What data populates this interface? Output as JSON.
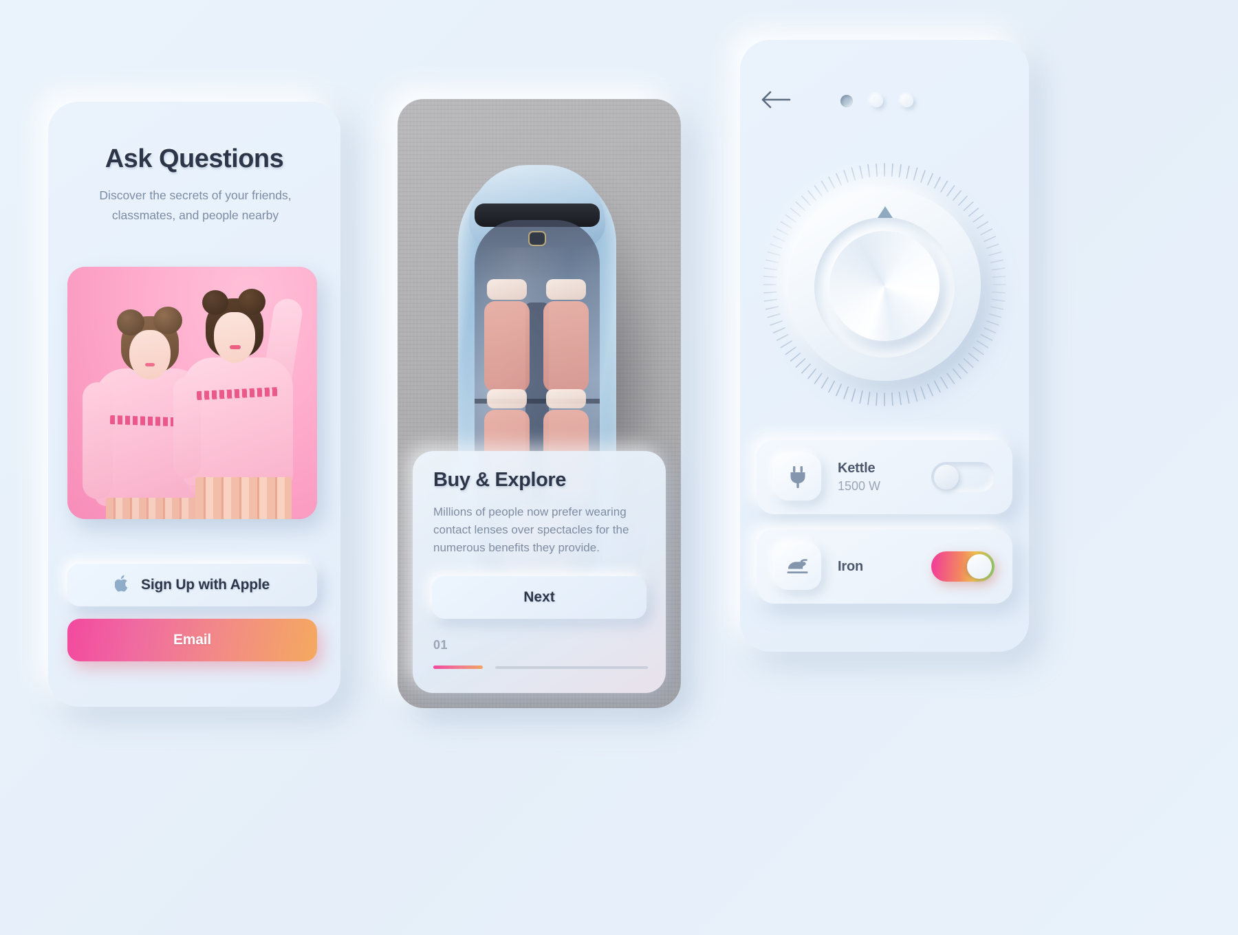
{
  "theme": {
    "background": "#e8f1fa",
    "card_surface": "#eaf3fc",
    "text_dark": "#2c3648",
    "text_muted": "#7b8ba3",
    "gradient_start": "#f3499f",
    "gradient_end": "#f5a95f"
  },
  "card_one": {
    "title": "Ask Questions",
    "subtitle": "Discover the secrets of your friends, classmates, and people nearby",
    "photo": {
      "alt": "Two women in pink sweatshirts on a pink background",
      "shirt_text": "ESTHERLOVESCHUU"
    },
    "apple_button": {
      "label": "Sign Up with Apple",
      "icon": "apple-icon",
      "glyph": ""
    },
    "email_button": {
      "label": "Email"
    }
  },
  "card_two": {
    "photo": {
      "alt": "Top-down view of a light blue concept car with pink seats"
    },
    "title": "Buy & Explore",
    "body": "Millions of people now prefer wearing contact lenses over spectacles for the numerous benefits they provide.",
    "next_button": {
      "label": "Next"
    },
    "step_label": "01",
    "progress": {
      "percent": 20
    }
  },
  "card_three": {
    "back_icon": "arrow-left-icon",
    "dots": [
      {
        "state": "active"
      },
      {
        "state": "idle"
      },
      {
        "state": "idle"
      }
    ],
    "knob": {
      "name": "rotary-dial",
      "pointer": "triangle-pointer"
    },
    "devices": [
      {
        "name": "Kettle",
        "power": "1500 W",
        "icon": "plug-icon",
        "toggle": "off"
      },
      {
        "name": "Iron",
        "power": "",
        "icon": "iron-icon",
        "toggle": "on"
      }
    ]
  }
}
